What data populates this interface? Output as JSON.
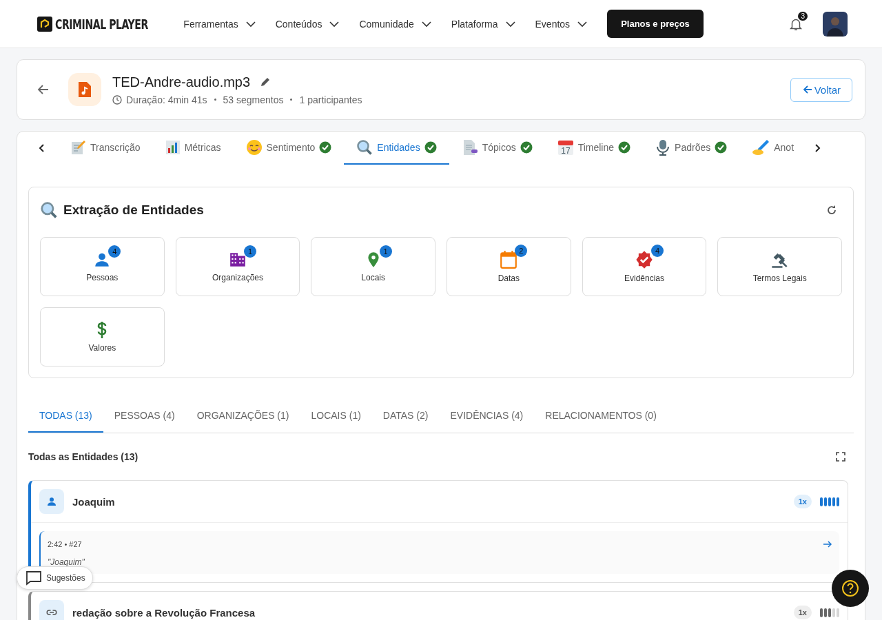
{
  "brand": "CRIMINAL PLAYER",
  "nav": [
    {
      "label": "Ferramentas"
    },
    {
      "label": "Conteúdos"
    },
    {
      "label": "Comunidade"
    },
    {
      "label": "Plataforma"
    },
    {
      "label": "Eventos"
    }
  ],
  "cta": "Planos e preços",
  "notifications": "3",
  "file": {
    "title": "TED-Andre-audio.mp3",
    "duration": "Duração: 4min 41s",
    "segments": "53 segmentos",
    "participants": "1 participantes",
    "back": "Voltar"
  },
  "tabs": [
    {
      "kind": "memo",
      "label": "Transcrição",
      "done": false,
      "selected": false
    },
    {
      "kind": "chart",
      "label": "Métricas",
      "done": false,
      "selected": false
    },
    {
      "kind": "smile",
      "label": "Sentimento",
      "done": true,
      "selected": false
    },
    {
      "kind": "search",
      "label": "Entidades",
      "done": true,
      "selected": true
    },
    {
      "kind": "doc",
      "label": "Tópicos",
      "done": true,
      "selected": false
    },
    {
      "kind": "calendar",
      "label": "Timeline",
      "done": true,
      "selected": false,
      "icon_text": "17"
    },
    {
      "kind": "mic",
      "label": "Padrões",
      "done": true,
      "selected": false
    },
    {
      "kind": "write",
      "label": "Anot",
      "done": false,
      "selected": false
    }
  ],
  "extraction": {
    "title": "Extração de Entidades",
    "cards": [
      {
        "kind": "person",
        "label": "Pessoas",
        "count": "4"
      },
      {
        "kind": "org",
        "label": "Organizações",
        "count": "1"
      },
      {
        "kind": "place",
        "label": "Locais",
        "count": "1"
      },
      {
        "kind": "date",
        "label": "Datas",
        "count": "2"
      },
      {
        "kind": "evidence",
        "label": "Evidências",
        "count": "4"
      },
      {
        "kind": "legal",
        "label": "Termos Legais"
      },
      {
        "kind": "money",
        "label": "Valores"
      }
    ]
  },
  "filters": [
    {
      "label": "TODAS (13)",
      "selected": true
    },
    {
      "label": "PESSOAS (4)",
      "selected": false
    },
    {
      "label": "ORGANIZAÇÕES (1)",
      "selected": false
    },
    {
      "label": "LOCAIS (1)",
      "selected": false
    },
    {
      "label": "DATAS (2)",
      "selected": false
    },
    {
      "label": "EVIDÊNCIAS (4)",
      "selected": false
    },
    {
      "label": "RELACIONAMENTOS (0)",
      "selected": false
    }
  ],
  "list_title": "Todas as Entidades (13)",
  "entities": [
    {
      "kind": "person",
      "name": "Joaquim",
      "count": "1x",
      "level": 1,
      "selected": true,
      "mentions": [
        {
          "meta": "2:42 • #27",
          "quote": "\"Joaquim\""
        }
      ]
    },
    {
      "kind": "link",
      "name": "redação sobre a Revolução Francesa",
      "count": "1x",
      "level": 0.6,
      "selected": false
    }
  ],
  "suggestions": "Sugestões"
}
